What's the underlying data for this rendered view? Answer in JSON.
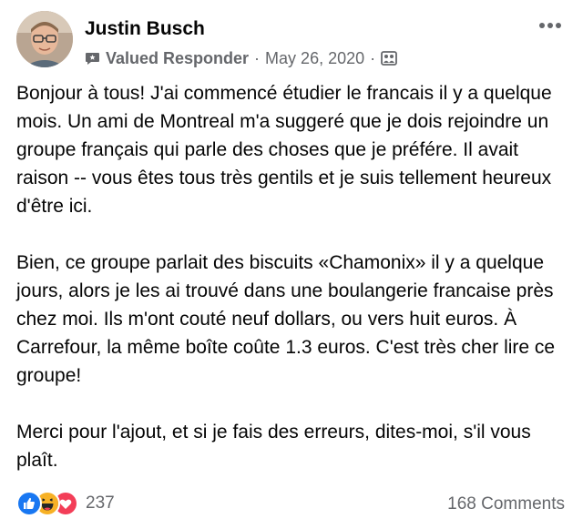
{
  "post": {
    "author": "Justin Busch",
    "badge": "Valued Responder",
    "separator": "·",
    "date": "May 26, 2020",
    "audience_icon": "group-audience-icon",
    "more_icon": "more-options-icon",
    "paragraphs": [
      "Bonjour à tous! J'ai commencé étudier le francais il y a quelque mois. Un ami de Montreal m'a suggeré que je dois rejoindre un groupe français qui parle des choses que je préfére. Il avait raison -- vous êtes tous très gentils et je suis tellement heureux d'être ici.",
      "Bien, ce groupe parlait des biscuits «Chamonix» il y a quelque jours, alors je les ai trouvé dans une boulangerie francaise près chez moi. Ils m'ont couté neuf dollars, ou vers huit euros. À Carrefour, la même boîte coûte 1.3 euros. C'est très cher lire ce groupe!",
      "Merci pour l'ajout, et si je fais des erreurs, dites-moi, s'il vous plaît."
    ]
  },
  "footer": {
    "reactions": [
      "like",
      "haha",
      "love"
    ],
    "reaction_count": "237",
    "comments": "168 Comments"
  },
  "colors": {
    "secondary_text": "#65676b",
    "like_blue": "#1877f2",
    "love_red": "#f33e58",
    "haha_yellow": "#f7b125"
  }
}
